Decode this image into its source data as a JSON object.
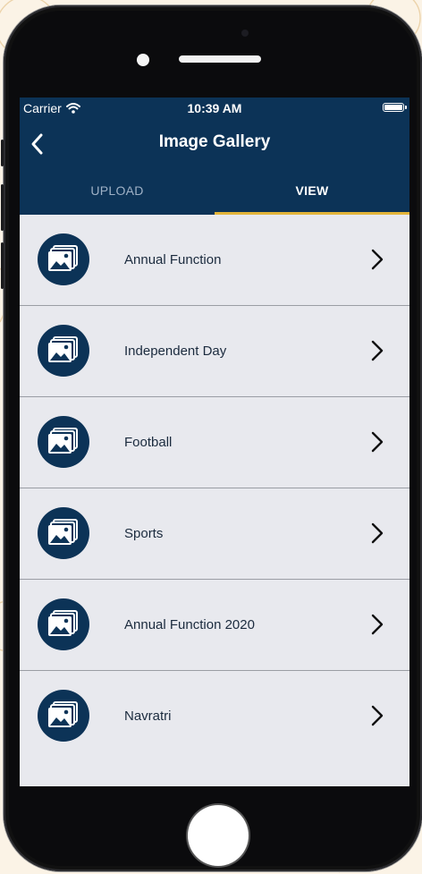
{
  "status_bar": {
    "carrier": "Carrier",
    "time": "10:39 AM"
  },
  "nav": {
    "title": "Image Gallery",
    "back_icon": "chevron-left-icon"
  },
  "tabs": [
    {
      "label": "UPLOAD",
      "active": false
    },
    {
      "label": "VIEW",
      "active": true
    }
  ],
  "gallery": {
    "items": [
      {
        "label": "Annual Function"
      },
      {
        "label": "Independent Day"
      },
      {
        "label": "Football"
      },
      {
        "label": "Sports"
      },
      {
        "label": "Annual Function 2020"
      },
      {
        "label": "Navratri"
      }
    ],
    "item_icon": "photo-album-icon",
    "row_chevron_icon": "chevron-right-icon"
  },
  "colors": {
    "primary": "#0c3357",
    "tab_indicator": "#e2b43a",
    "list_background": "#e8e9ee"
  }
}
